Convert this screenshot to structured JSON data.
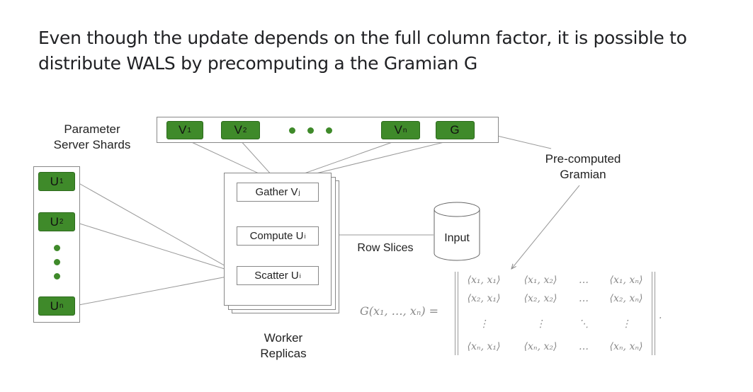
{
  "title": "Even though the update depends on the full column factor, it is possible to distribute WALS by precomputing a the Gramian G",
  "labels": {
    "param_server": [
      "Parameter",
      "Server Shards"
    ],
    "precomputed": [
      "Pre-computed",
      "Gramian"
    ],
    "row_slices": "Row Slices",
    "worker": [
      "Worker",
      "Replicas"
    ],
    "input": "Input"
  },
  "column_shards": [
    {
      "base": "V",
      "sub": "1"
    },
    {
      "base": "V",
      "sub": "2"
    },
    {
      "base": "V",
      "sub": "n"
    },
    {
      "base": "G",
      "sub": ""
    }
  ],
  "row_shards": [
    {
      "base": "U",
      "sub": "1"
    },
    {
      "base": "U",
      "sub": "2"
    },
    {
      "base": "U",
      "sub": "n"
    }
  ],
  "steps": [
    {
      "base": "Gather V",
      "sub": "j"
    },
    {
      "base": "Compute U",
      "sub": "i"
    },
    {
      "base": "Scatter U",
      "sub": "i"
    }
  ],
  "formula": {
    "lhs": "G(x₁, …, xₙ) =",
    "matrix": [
      [
        "⟨x₁, x₁⟩",
        "⟨x₁, x₂⟩",
        "…",
        "⟨x₁, xₙ⟩"
      ],
      [
        "⟨x₂, x₁⟩",
        "⟨x₂, x₂⟩",
        "…",
        "⟨x₂, xₙ⟩"
      ],
      [
        "⋮",
        "⋮",
        "⋱",
        "⋮"
      ],
      [
        "⟨xₙ, x₁⟩",
        "⟨xₙ, x₂⟩",
        "…",
        "⟨xₙ, xₙ⟩"
      ]
    ],
    "tail": "."
  },
  "colors": {
    "shard": "#3f8a2a",
    "line": "#888888"
  }
}
